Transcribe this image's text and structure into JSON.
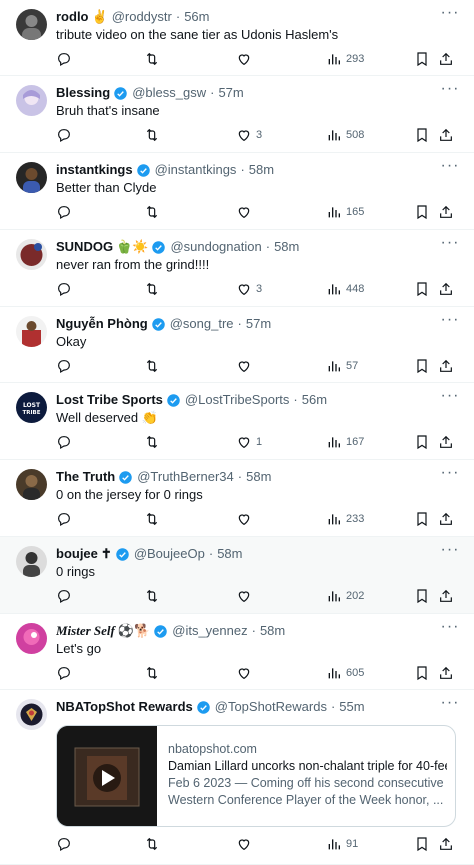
{
  "tweets": [
    {
      "name": "rodlo",
      "extra": "✌",
      "verified": false,
      "handle": "@roddystr",
      "time": "56m",
      "text": "tribute video on the sane tier as Udonis Haslem's",
      "likes": "",
      "views": "293",
      "avatar_color": "#3a3a3a"
    },
    {
      "name": "Blessing",
      "extra": "",
      "verified": true,
      "handle": "@bless_gsw",
      "time": "57m",
      "text": "Bruh that's insane",
      "likes": "3",
      "views": "508",
      "avatar_color": "#c9c3e6"
    },
    {
      "name": "instantkings",
      "extra": "",
      "verified": true,
      "handle": "@instantkings",
      "time": "58m",
      "text": "Better than Clyde",
      "likes": "",
      "views": "165",
      "avatar_color": "#262626"
    },
    {
      "name": "SUNDOG",
      "extra": "🫑☀️",
      "verified": true,
      "handle": "@sundognation",
      "time": "58m",
      "text": "never ran from the grind!!!!",
      "likes": "3",
      "views": "448",
      "avatar_color": "#7a2a2a"
    },
    {
      "name": "Nguyễn Phòng",
      "extra": "",
      "verified": true,
      "handle": "@song_tre",
      "time": "57m",
      "text": "Okay",
      "likes": "",
      "views": "57",
      "avatar_color": "#b03030"
    },
    {
      "name": "Lost Tribe Sports",
      "extra": "",
      "verified": true,
      "handle": "@LostTribeSports",
      "time": "56m",
      "text": "Well deserved 👏",
      "likes": "1",
      "views": "167",
      "avatar_color": "#0d1b3d"
    },
    {
      "name": "The Truth",
      "extra": "",
      "verified": true,
      "handle": "@TruthBerner34",
      "time": "58m",
      "text": "0 on the jersey for 0 rings",
      "likes": "",
      "views": "233",
      "avatar_color": "#4a3b2a"
    },
    {
      "name": "boujee",
      "extra": "✝",
      "verified": true,
      "handle": "@BoujeeOp",
      "time": "58m",
      "text": "0 rings",
      "likes": "",
      "views": "202",
      "avatar_color": "#333333"
    },
    {
      "name": "Mister Self",
      "extra": "⚽️🐕",
      "verified": true,
      "handle": "@its_yennez",
      "time": "58m",
      "text": "Let's go",
      "likes": "",
      "views": "605",
      "avatar_color": "#d040a0"
    },
    {
      "name": "NBATopShot Rewards",
      "extra": "",
      "verified": true,
      "handle": "@TopShotRewards",
      "time": "55m",
      "text": "",
      "likes": "",
      "views": "91",
      "avatar_color": "#e6e6ee"
    }
  ],
  "card": {
    "domain": "nbatopshot.com",
    "title": "Damian Lillard uncorks non-chalant triple for 40-fee",
    "description_line1": "Feb 6 2023 — Coming off his second consecutive",
    "description_line2": "Western Conference Player of the Week honor, ..."
  },
  "colors": {
    "verified": "#1d9bf0",
    "muted": "#536471",
    "text": "#0f1419",
    "divider": "#eff3f4"
  }
}
